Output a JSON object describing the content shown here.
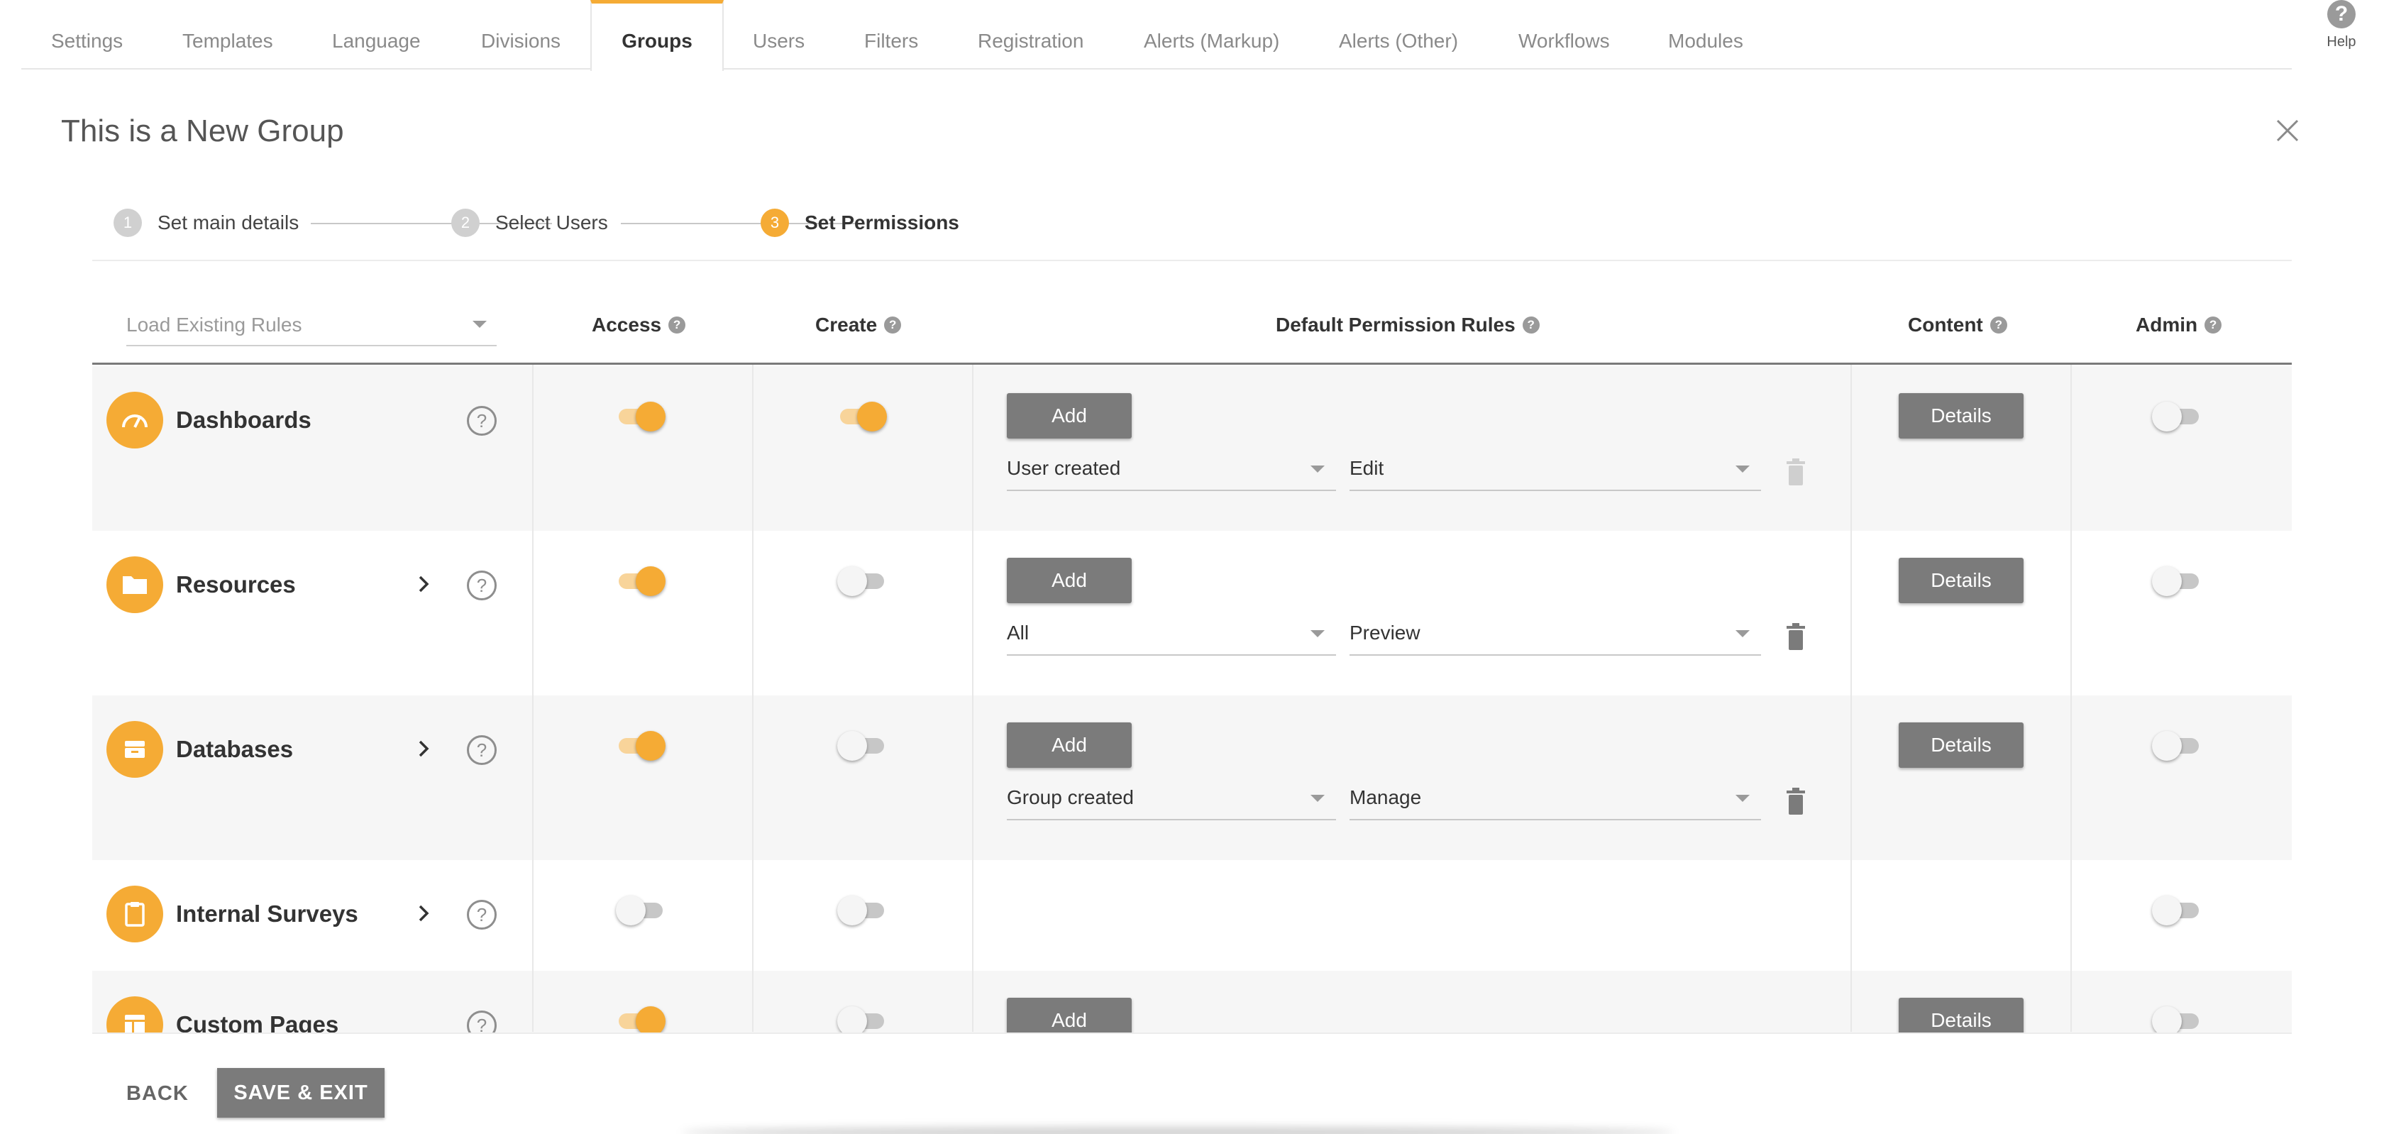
{
  "tabs": [
    {
      "label": "Settings"
    },
    {
      "label": "Templates"
    },
    {
      "label": "Language"
    },
    {
      "label": "Divisions"
    },
    {
      "label": "Groups",
      "active": true
    },
    {
      "label": "Users"
    },
    {
      "label": "Filters"
    },
    {
      "label": "Registration"
    },
    {
      "label": "Alerts (Markup)"
    },
    {
      "label": "Alerts (Other)"
    },
    {
      "label": "Workflows"
    },
    {
      "label": "Modules"
    }
  ],
  "help": {
    "icon": "help-icon",
    "label": "Help"
  },
  "dialog": {
    "title": "This is a New Group",
    "close_icon": "close-icon"
  },
  "stepper": [
    {
      "number": "1",
      "label": "Set main details"
    },
    {
      "number": "2",
      "label": "Select Users"
    },
    {
      "number": "3",
      "label": "Set Permissions",
      "active": true
    }
  ],
  "table": {
    "load_rules_placeholder": "Load Existing Rules",
    "headers": {
      "access": "Access",
      "create": "Create",
      "default_rules": "Default Permission Rules",
      "content": "Content",
      "admin": "Admin"
    },
    "rows": [
      {
        "name": "Dashboards",
        "icon": "gauge-icon",
        "expandable": false,
        "access": true,
        "create": true,
        "add_label": "Add",
        "rule_scope": "User created",
        "rule_permission": "Edit",
        "rule_deletable": false,
        "details_label": "Details",
        "admin": false
      },
      {
        "name": "Resources",
        "icon": "folder-icon",
        "expandable": true,
        "access": true,
        "create": false,
        "add_label": "Add",
        "rule_scope": "All",
        "rule_permission": "Preview",
        "rule_deletable": true,
        "details_label": "Details",
        "admin": false
      },
      {
        "name": "Databases",
        "icon": "database-icon",
        "expandable": true,
        "access": true,
        "create": false,
        "add_label": "Add",
        "rule_scope": "Group created",
        "rule_permission": "Manage",
        "rule_deletable": true,
        "details_label": "Details",
        "admin": false
      },
      {
        "name": "Internal Surveys",
        "icon": "clipboard-icon",
        "expandable": true,
        "access": false,
        "create": false,
        "admin": false
      },
      {
        "name": "Custom Pages",
        "icon": "page-layout-icon",
        "expandable": false,
        "access": true,
        "create": false,
        "add_label": "Add",
        "details_label": "Details",
        "admin": false
      }
    ]
  },
  "footer": {
    "back_label": "BACK",
    "save_label": "SAVE & EXIT"
  },
  "colors": {
    "accent": "#f5ab35",
    "button": "#7b7b7b"
  }
}
